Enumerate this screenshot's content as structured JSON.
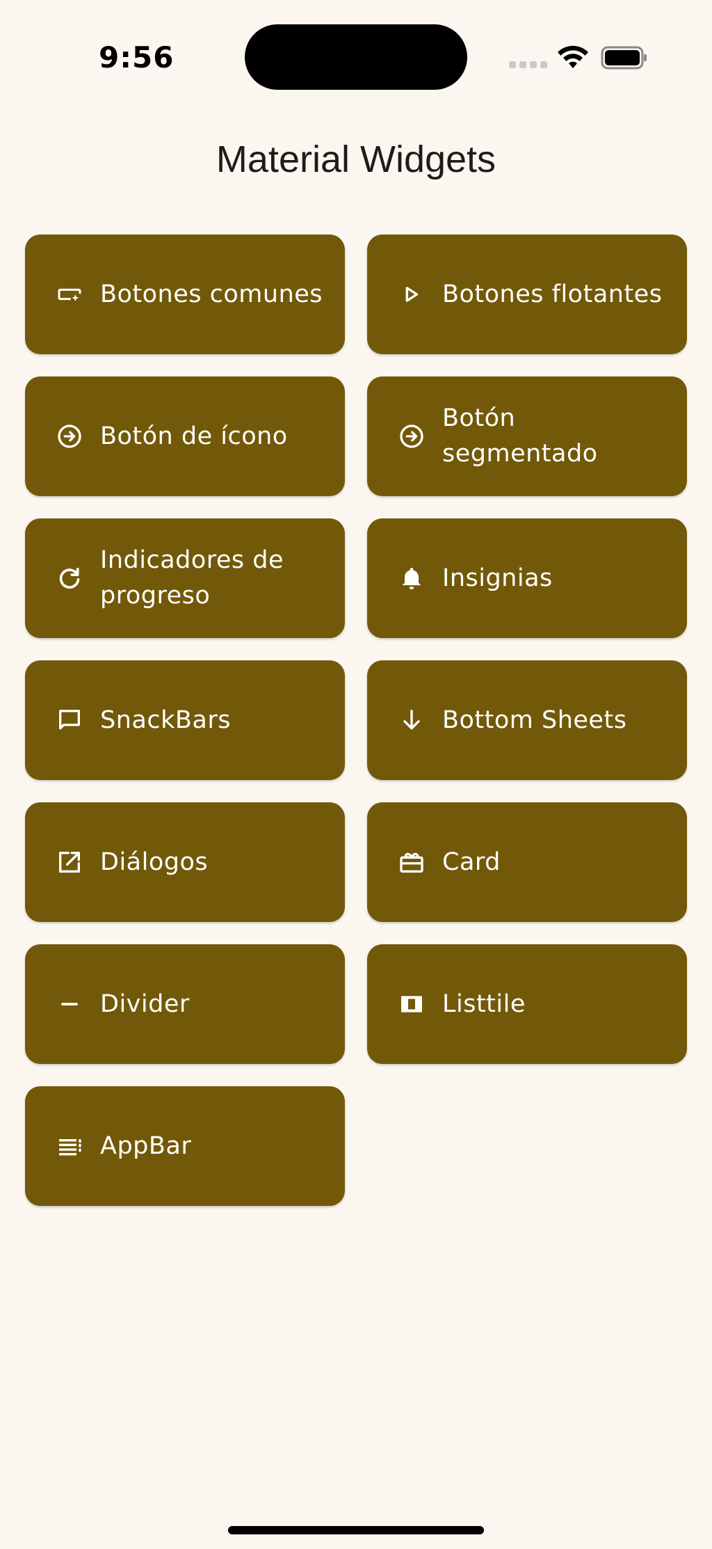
{
  "status_bar": {
    "time": "9:56"
  },
  "header": {
    "title": "Material Widgets"
  },
  "colors": {
    "background": "#FBF6F0",
    "tile": "#725909",
    "tile_text": "#FFFFFF",
    "title_text": "#1F1B16"
  },
  "tiles": [
    {
      "label": "Botones comunes",
      "icon": "smart-button-icon"
    },
    {
      "label": "Botones flotantes",
      "icon": "play-arrow-icon"
    },
    {
      "label": "Botón de ícono",
      "icon": "arrow-circle-right-icon"
    },
    {
      "label": "Botón segmentado",
      "icon": "arrow-circle-right-icon"
    },
    {
      "label": "Indicadores de progreso",
      "icon": "refresh-icon"
    },
    {
      "label": "Insignias",
      "icon": "bell-icon"
    },
    {
      "label": "SnackBars",
      "icon": "chat-bubble-icon"
    },
    {
      "label": "Bottom Sheets",
      "icon": "arrow-down-icon"
    },
    {
      "label": "Diálogos",
      "icon": "open-in-new-icon"
    },
    {
      "label": "Card",
      "icon": "card-giftcard-icon"
    },
    {
      "label": "Divider",
      "icon": "minus-icon"
    },
    {
      "label": "Listtile",
      "icon": "view-column-icon"
    },
    {
      "label": "AppBar",
      "icon": "list-lines-icon"
    }
  ]
}
